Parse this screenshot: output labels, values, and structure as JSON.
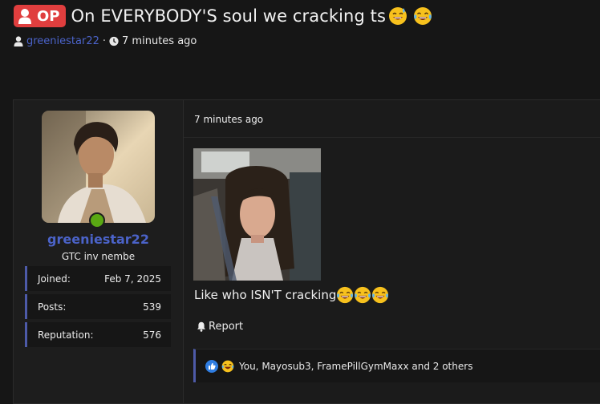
{
  "thread": {
    "op_badge": "OP",
    "title": "On EVERYBODY'S soul we cracking ts",
    "title_emojis": [
      "smiling-with-sweat-emoji",
      "tears-of-joy-emoji"
    ],
    "author": "greeniestar22",
    "separator": "·",
    "time": "7 minutes ago"
  },
  "post": {
    "user": {
      "username": "greeniestar22",
      "title": "GTC inv nembe",
      "online": true,
      "stats": [
        {
          "label": "Joined:",
          "value": "Feb 7, 2025"
        },
        {
          "label": "Posts:",
          "value": "539"
        },
        {
          "label": "Reputation:",
          "value": "576"
        }
      ]
    },
    "time": "7 minutes ago",
    "body": "Like who ISN'T cracking",
    "body_emojis": [
      "tears-of-joy-emoji",
      "tears-of-joy-emoji",
      "tears-of-joy-emoji"
    ],
    "report_label": "Report",
    "reactions": {
      "icons": [
        "like-reaction-icon",
        "laugh-reaction-icon"
      ],
      "text": "You, Mayosub3, FramePillGymMaxx and 2 others"
    }
  },
  "colors": {
    "background": "#161616",
    "op_badge": "#e03e3e",
    "link_blue": "#4b63c9",
    "accent_border": "#4d5aa8",
    "online_green": "#5aa813"
  }
}
